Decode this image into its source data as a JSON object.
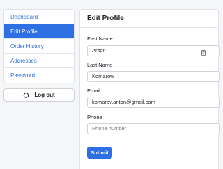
{
  "sidebar": {
    "items": [
      {
        "label": "Dashboard"
      },
      {
        "label": "Edit Profile"
      },
      {
        "label": "Order History"
      },
      {
        "label": "Addresses"
      },
      {
        "label": "Password"
      }
    ],
    "active_index": 1,
    "logout": {
      "label": "Log out",
      "icon": "power-icon"
    }
  },
  "form": {
    "title": "Edit Profile",
    "first_name": {
      "label": "First Name",
      "value": "Anton"
    },
    "last_name": {
      "label": "Last Name",
      "value": "Komarow"
    },
    "email": {
      "label": "Email",
      "value": "komarov.anton@gmail.com"
    },
    "phone": {
      "label": "Phone",
      "placeholder": "Phone number"
    },
    "submit_label": "Submit"
  },
  "colors": {
    "accent": "#2f6fe4"
  }
}
